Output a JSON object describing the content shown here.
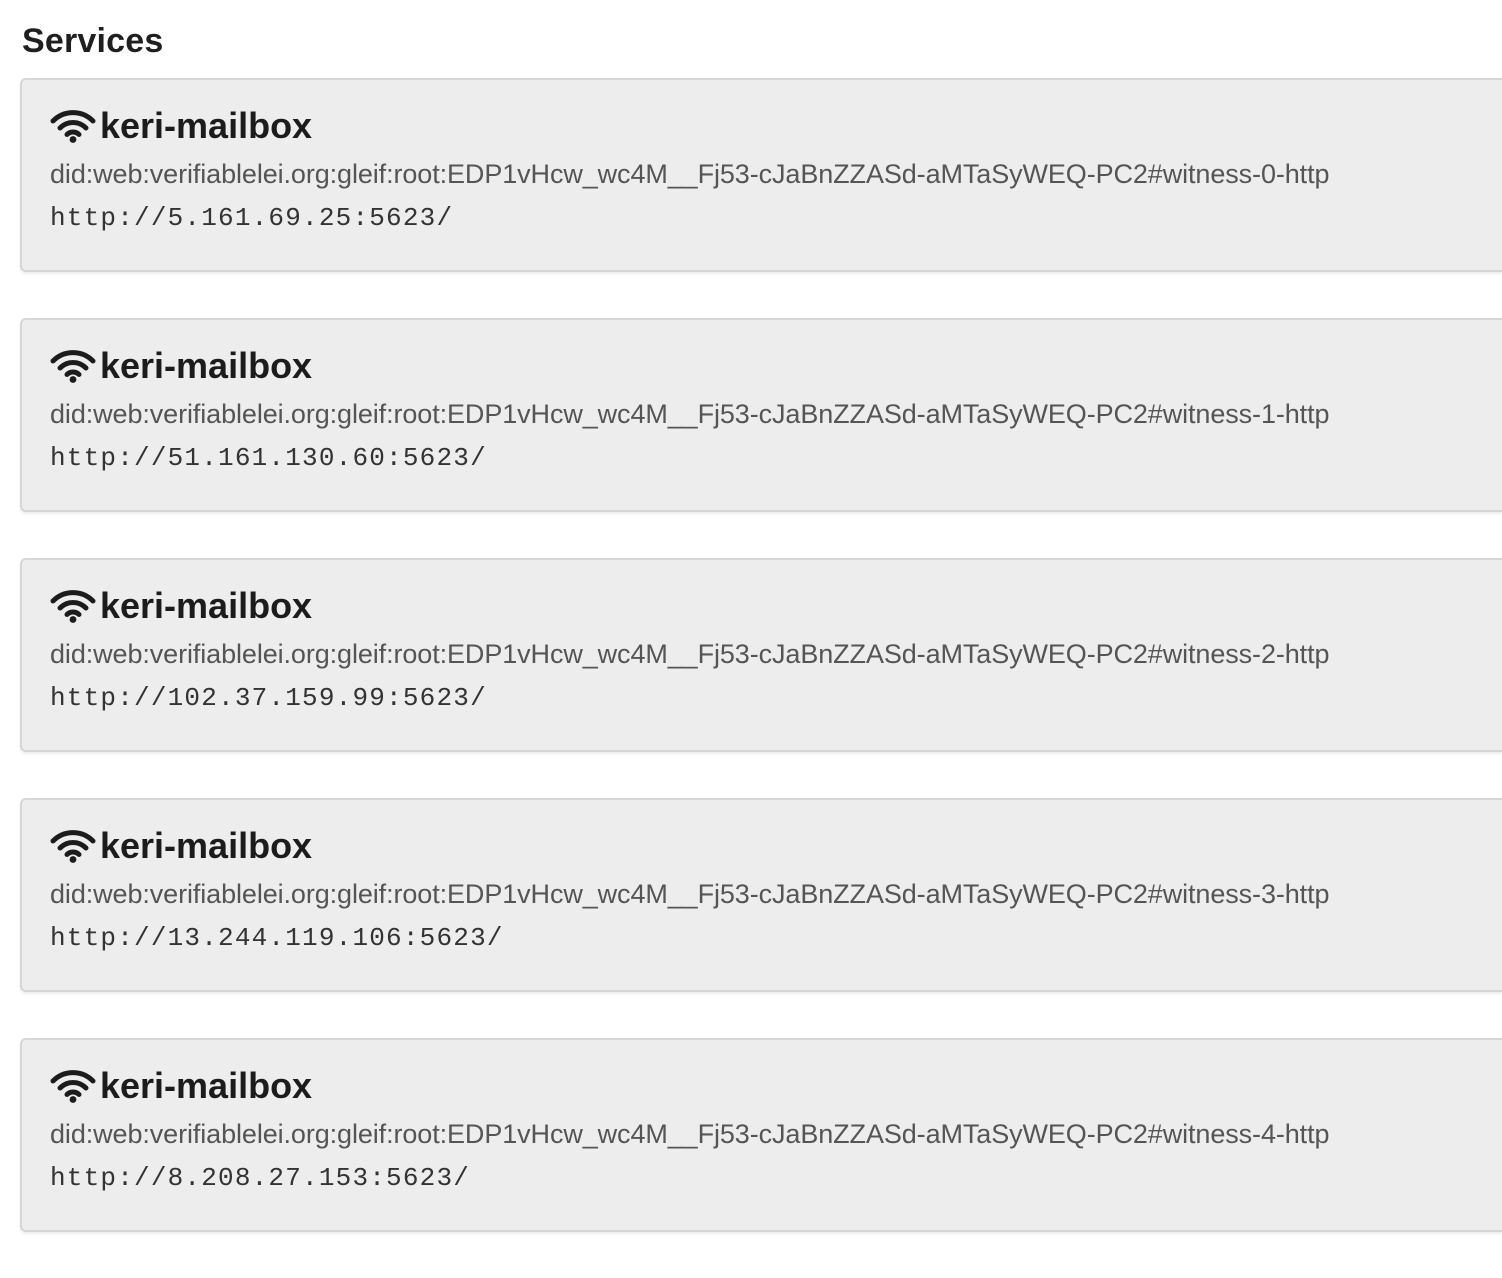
{
  "title": "Services",
  "services": [
    {
      "icon": "wifi-icon",
      "type": "keri-mailbox",
      "id": "did:web:verifiablelei.org:gleif:root:EDP1vHcw_wc4M__Fj53-cJaBnZZASd-aMTaSyWEQ-PC2#witness-0-http",
      "endpoint": "http://5.161.69.25:5623/"
    },
    {
      "icon": "wifi-icon",
      "type": "keri-mailbox",
      "id": "did:web:verifiablelei.org:gleif:root:EDP1vHcw_wc4M__Fj53-cJaBnZZASd-aMTaSyWEQ-PC2#witness-1-http",
      "endpoint": "http://51.161.130.60:5623/"
    },
    {
      "icon": "wifi-icon",
      "type": "keri-mailbox",
      "id": "did:web:verifiablelei.org:gleif:root:EDP1vHcw_wc4M__Fj53-cJaBnZZASd-aMTaSyWEQ-PC2#witness-2-http",
      "endpoint": "http://102.37.159.99:5623/"
    },
    {
      "icon": "wifi-icon",
      "type": "keri-mailbox",
      "id": "did:web:verifiablelei.org:gleif:root:EDP1vHcw_wc4M__Fj53-cJaBnZZASd-aMTaSyWEQ-PC2#witness-3-http",
      "endpoint": "http://13.244.119.106:5623/"
    },
    {
      "icon": "wifi-icon",
      "type": "keri-mailbox",
      "id": "did:web:verifiablelei.org:gleif:root:EDP1vHcw_wc4M__Fj53-cJaBnZZASd-aMTaSyWEQ-PC2#witness-4-http",
      "endpoint": "http://8.208.27.153:5623/"
    }
  ]
}
